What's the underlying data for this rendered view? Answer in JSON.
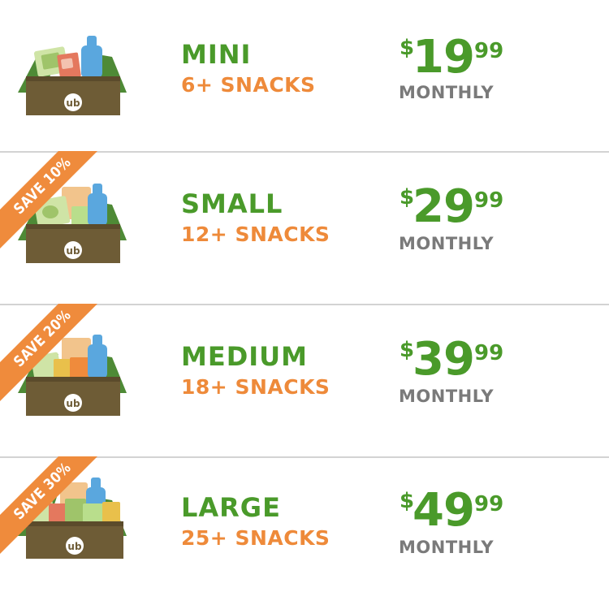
{
  "colors": {
    "plan_name": "#4a9a2a",
    "snack_count": "#ee8a3a",
    "price": "#4a9a2a",
    "period": "#7a7a7a",
    "ribbon": "#ef8b3c",
    "divider": "#d3d3d3",
    "box": "#6e5c36"
  },
  "box_logo_text": "ub",
  "plans": [
    {
      "name": "MINI",
      "snacks": "6+ SNACKS",
      "currency": "$",
      "price_whole": "19",
      "price_cents": "99",
      "period": "MONTHLY",
      "badge": ""
    },
    {
      "name": "SMALL",
      "snacks": "12+ SNACKS",
      "currency": "$",
      "price_whole": "29",
      "price_cents": "99",
      "period": "MONTHLY",
      "badge": "SAVE 10%"
    },
    {
      "name": "MEDIUM",
      "snacks": "18+ SNACKS",
      "currency": "$",
      "price_whole": "39",
      "price_cents": "99",
      "period": "MONTHLY",
      "badge": "SAVE 20%"
    },
    {
      "name": "LARGE",
      "snacks": "25+ SNACKS",
      "currency": "$",
      "price_whole": "49",
      "price_cents": "99",
      "period": "MONTHLY",
      "badge": "SAVE 30%"
    }
  ]
}
